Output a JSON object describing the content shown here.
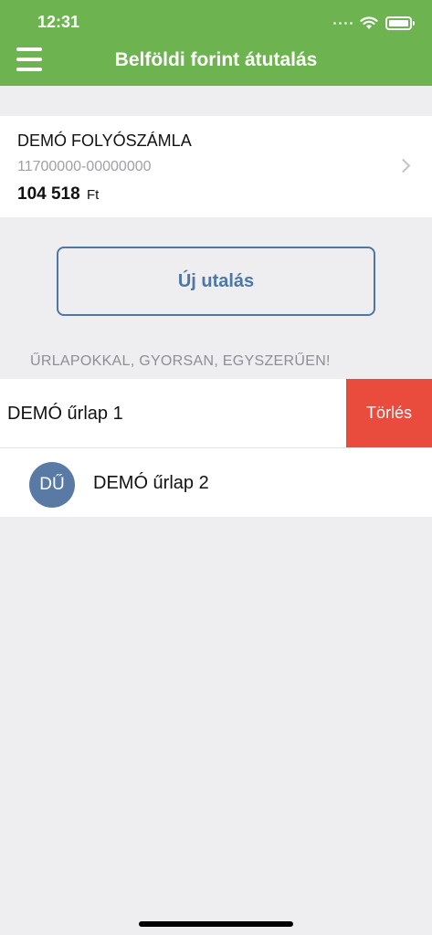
{
  "status_bar": {
    "time": "12:31"
  },
  "header": {
    "title": "Belföldi forint átutalás",
    "accent": "#6db34f"
  },
  "account": {
    "name": "DEMÓ FOLYÓSZÁMLA",
    "number": "11700000-00000000",
    "balance_amount": "104 518",
    "balance_currency": "Ft"
  },
  "new_transfer_label": "Új utalás",
  "templates": {
    "section_title": "ŰRLAPOKKAL, GYORSAN, EGYSZERŰEN!",
    "items": [
      {
        "label": "DEMÓ űrlap 1",
        "action_label": "Törlés",
        "action_color": "#e94b3c"
      },
      {
        "label": "DEMÓ űrlap 2",
        "avatar_initials": "DŰ",
        "avatar_color": "#5a7aa6"
      }
    ]
  }
}
